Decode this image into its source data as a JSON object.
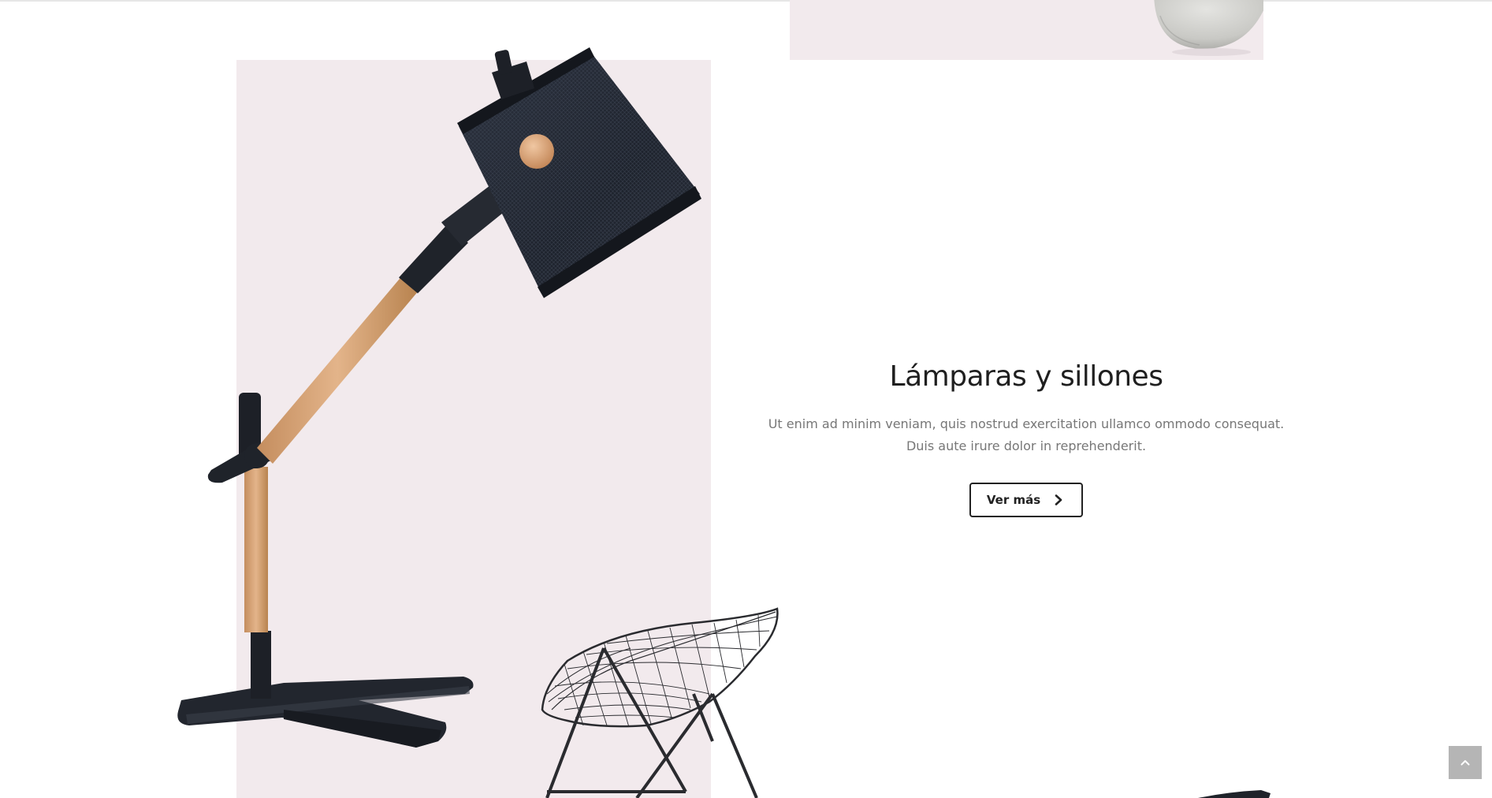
{
  "section": {
    "title": "Lámparas y sillones",
    "description_lines": [
      "Ut enim ad minim veniam, quis nostrud exercitation ullamco ommodo consequat.",
      "Duis aute irure dolor in reprehenderit."
    ],
    "button_label": "Ver más",
    "button_icon": "chevron-right-icon"
  },
  "images": {
    "top_product": "concrete-vase",
    "main_product": "desk-lamp",
    "secondary_product": "wire-chair",
    "corner_product": "dark-object-partial"
  },
  "controls": {
    "scroll_top_icon": "chevron-up-icon"
  },
  "colors": {
    "panel_background": "#f2eaed",
    "heading": "#1f1f1f",
    "body_text": "#777777",
    "button_border": "#222222",
    "scroll_top_background": "#b5b5b5"
  }
}
